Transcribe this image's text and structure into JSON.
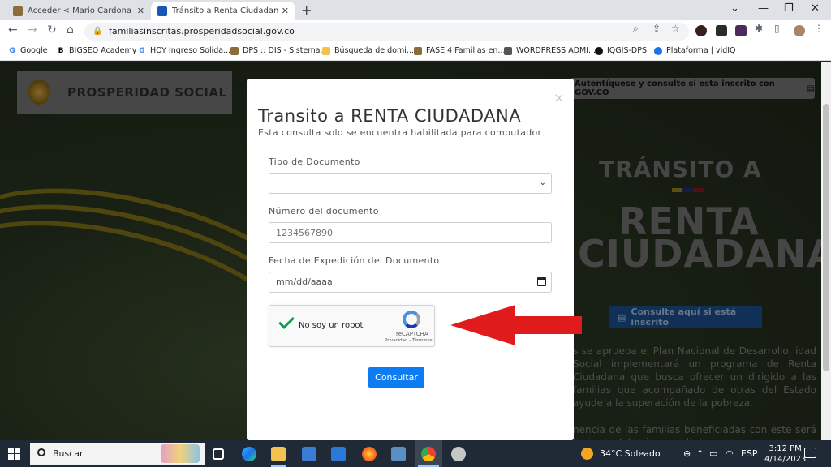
{
  "browser": {
    "tabs": [
      {
        "title": "Acceder < Mario Cardona Mas Fr",
        "active": false
      },
      {
        "title": "Tránsito a Renta Ciudadana - Pro",
        "active": true
      }
    ],
    "url": "familiasinscritas.prosperidadsocial.gov.co",
    "bookmarks": [
      {
        "label": "Google"
      },
      {
        "label": "BIGSEO Academy"
      },
      {
        "label": "HOY Ingreso Solida..."
      },
      {
        "label": "DPS :: DIS - Sistema..."
      },
      {
        "label": "Búsqueda de domi..."
      },
      {
        "label": "FASE 4 Familias en..."
      },
      {
        "label": "WORDPRESS ADMI..."
      },
      {
        "label": "IQGIS-DPS"
      },
      {
        "label": "Plataforma | vidIQ"
      }
    ]
  },
  "background": {
    "logo_text": "PROSPERIDAD SOCIAL",
    "govco_button": "Autentíquese y consulte si esta inscrito con GOV.CO",
    "hero_line1": "TRÁNSITO A",
    "hero_line2": "RENTA",
    "hero_line3": "CIUDADANA",
    "consult_button": "Consulte aquí si está inscrito",
    "para1": "s se aprueba el Plan Nacional de Desarrollo, idad Social implementará un programa de Renta Ciudadana que busca ofrecer un dirigido a las familias que acompañado de otras del Estado ayude a la superación de la pobreza.",
    "para2": "nencia de las familias beneficiadas con este será limitada deberán cumplir los"
  },
  "modal": {
    "title": "Transito a RENTA CIUDADANA",
    "subtitle": "Esta consulta solo se encuentra habilitada para computador",
    "close": "×",
    "fields": {
      "doc_type_label": "Tipo de Documento",
      "doc_type_value": "",
      "doc_number_label": "Número del documento",
      "doc_number_placeholder": "1234567890",
      "exp_date_label": "Fecha de Expedición del Documento",
      "exp_date_placeholder": "mm/dd/aaaa"
    },
    "recaptcha": {
      "label": "No soy un robot",
      "brand": "reCAPTCHA",
      "terms": "Privacidad - Términos",
      "checked": true
    },
    "submit_label": "Consultar"
  },
  "taskbar": {
    "search_label": "Buscar",
    "weather": "34°C  Soleado",
    "lang": "ESP",
    "time": "3:12 PM",
    "date": "4/14/2023"
  },
  "colors": {
    "primary_button": "#0d7bf2",
    "check_green": "#109d58",
    "arrow_red": "#e01b1b"
  }
}
